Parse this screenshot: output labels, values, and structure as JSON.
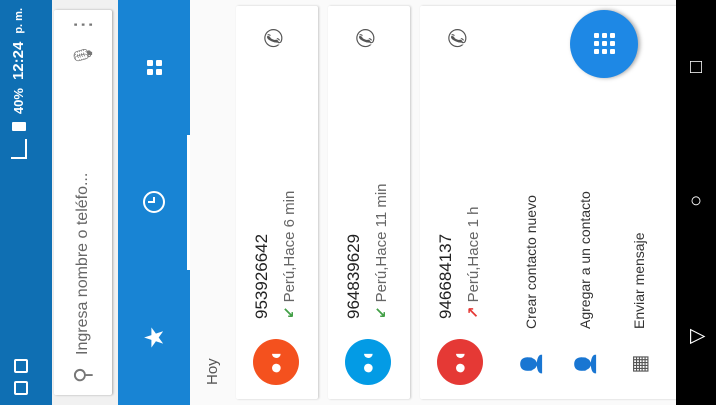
{
  "status_bar": {
    "battery": "40%",
    "time": "12:24",
    "ampm": "p. m."
  },
  "search": {
    "placeholder": "Ingresa nombre o teléfo..."
  },
  "tabs": [
    {
      "name": "favorites"
    },
    {
      "name": "recents"
    },
    {
      "name": "contacts"
    }
  ],
  "section_label": "Hoy",
  "calls": [
    {
      "number": "953926642",
      "detail": "Perú,Hace 6 min",
      "type": "incoming",
      "color": "#f4511e"
    },
    {
      "number": "964839629",
      "detail": "Perú,Hace 11 min",
      "type": "incoming",
      "color": "#039be5"
    },
    {
      "number": "946684137",
      "detail": "Perú,Hace 1 h",
      "type": "outgoing",
      "color": "#e53935"
    }
  ],
  "actions": [
    {
      "label": "Crear contacto nuevo"
    },
    {
      "label": "Agregar a un contacto"
    },
    {
      "label": "Enviar mensaje"
    }
  ],
  "nav": {
    "back": "▽",
    "home": "○",
    "recents": "□"
  }
}
